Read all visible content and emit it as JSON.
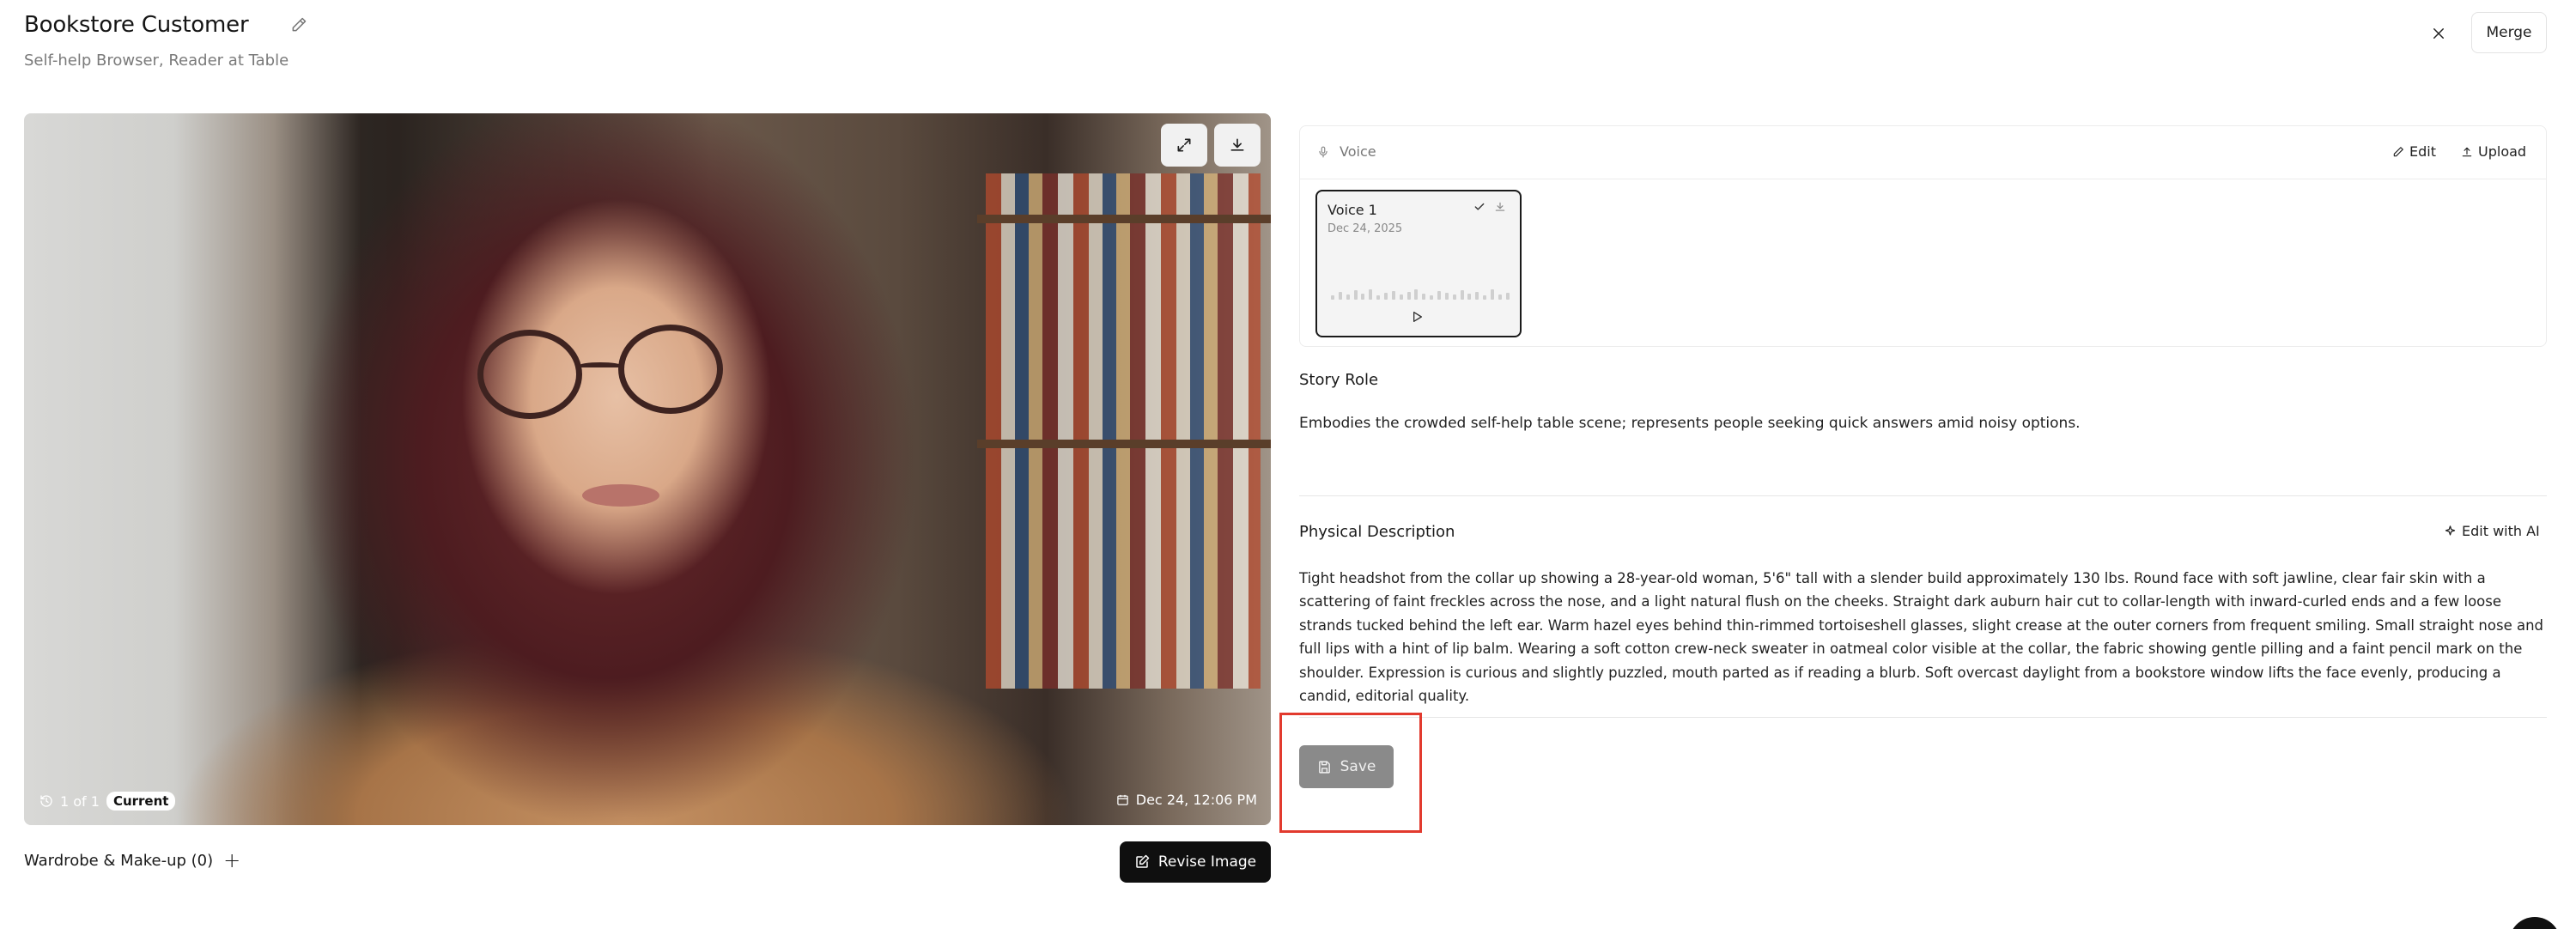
{
  "header": {
    "title": "Bookstore Customer",
    "subtitle": "Self-help Browser, Reader at Table",
    "merge_label": "Merge"
  },
  "image": {
    "version_text": "1 of 1",
    "current_badge": "Current",
    "date_text": "Dec 24, 12:06 PM"
  },
  "wardrobe": {
    "label": "Wardrobe & Make-up (0)"
  },
  "revise_label": "Revise Image",
  "voice": {
    "section_label": "Voice",
    "edit_label": "Edit",
    "upload_label": "Upload",
    "tile": {
      "name": "Voice 1",
      "date": "Dec 24, 2025"
    }
  },
  "story_role": {
    "title": "Story Role",
    "text": "Embodies the crowded self-help table scene; represents people seeking quick answers amid noisy options."
  },
  "physical_description": {
    "title": "Physical Description",
    "edit_ai_label": "Edit with AI",
    "text": "Tight headshot from the collar up showing a 28-year-old woman, 5'6\" tall with a slender build approximately 130 lbs. Round face with soft jawline, clear fair skin with a scattering of faint freckles across the nose, and a light natural flush on the cheeks. Straight dark auburn hair cut to collar-length with inward-curled ends and a few loose strands tucked behind the left ear. Warm hazel eyes behind thin-rimmed tortoiseshell glasses, slight crease at the outer corners from frequent smiling. Small straight nose and full lips with a hint of lip balm. Wearing a soft cotton crew-neck sweater in oatmeal color visible at the collar, the fabric showing gentle pilling and a faint pencil mark on the shoulder. Expression is curious and slightly puzzled, mouth parted as if reading a blurb. Soft overcast daylight from a bookstore window lifts the face evenly, producing a candid, editorial quality."
  },
  "save_label": "Save"
}
